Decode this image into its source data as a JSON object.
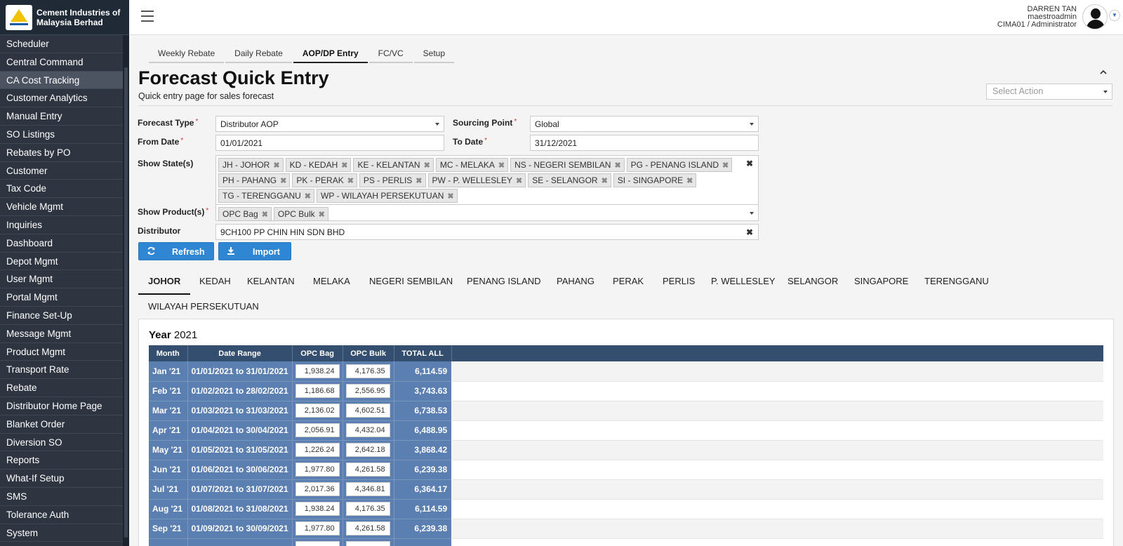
{
  "app": {
    "company_name_line1": "Cement Industries of",
    "company_name_line2": "Malaysia Berhad"
  },
  "sidebar": {
    "items": [
      {
        "label": "Scheduler"
      },
      {
        "label": "Central Command"
      },
      {
        "label": "CA Cost Tracking",
        "active": true
      },
      {
        "label": "Customer Analytics"
      },
      {
        "label": "Manual Entry"
      },
      {
        "label": "SO Listings"
      },
      {
        "label": "Rebates by PO"
      },
      {
        "label": "Customer"
      },
      {
        "label": "Tax Code"
      },
      {
        "label": "Vehicle Mgmt"
      },
      {
        "label": "Inquiries"
      },
      {
        "label": "Dashboard"
      },
      {
        "label": "Depot Mgmt"
      },
      {
        "label": "User Mgmt"
      },
      {
        "label": "Portal Mgmt"
      },
      {
        "label": "Finance Set-Up"
      },
      {
        "label": "Message Mgmt"
      },
      {
        "label": "Product Mgmt"
      },
      {
        "label": "Transport Rate"
      },
      {
        "label": "Rebate"
      },
      {
        "label": "Distributor Home Page"
      },
      {
        "label": "Blanket Order"
      },
      {
        "label": "Diversion SO"
      },
      {
        "label": "Reports"
      },
      {
        "label": "What-If Setup"
      },
      {
        "label": "SMS"
      },
      {
        "label": "Tolerance Auth"
      },
      {
        "label": "System"
      }
    ]
  },
  "user": {
    "name": "DARREN TAN",
    "login": "maestroadmin",
    "role": "CIMA01 / Administrator"
  },
  "tabs": [
    {
      "label": "Weekly Rebate"
    },
    {
      "label": "Daily Rebate"
    },
    {
      "label": "AOP/DP Entry",
      "active": true
    },
    {
      "label": "FC/VC"
    },
    {
      "label": "Setup"
    }
  ],
  "page": {
    "title": "Forecast Quick Entry",
    "subtitle": "Quick entry page for sales forecast",
    "action_placeholder": "Select Action"
  },
  "form": {
    "forecast_type": {
      "label": "Forecast Type",
      "value": "Distributor AOP"
    },
    "sourcing_point": {
      "label": "Sourcing Point",
      "value": "Global"
    },
    "from_date": {
      "label": "From Date",
      "value": "01/01/2021"
    },
    "to_date": {
      "label": "To Date",
      "value": "31/12/2021"
    },
    "states": {
      "label": "Show State(s)",
      "tags": [
        "JH - JOHOR",
        "KD - KEDAH",
        "KE - KELANTAN",
        "MC - MELAKA",
        "NS - NEGERI SEMBILAN",
        "PG - PENANG ISLAND",
        "PH - PAHANG",
        "PK - PERAK",
        "PS - PERLIS",
        "PW - P. WELLESLEY",
        "SE - SELANGOR",
        "SI - SINGAPORE",
        "TG - TERENGGANU",
        "WP - WILAYAH PERSEKUTUAN"
      ]
    },
    "products": {
      "label": "Show Product(s)",
      "tags": [
        "OPC Bag",
        "OPC Bulk"
      ]
    },
    "distributor": {
      "label": "Distributor",
      "value": "9CH100 PP CHIN HIN SDN BHD"
    },
    "refresh_label": "Refresh",
    "import_label": "Import",
    "icons": {
      "refresh": "refresh-icon",
      "import": "download-icon"
    }
  },
  "state_tabs": [
    {
      "label": "JOHOR",
      "active": true
    },
    {
      "label": "KEDAH"
    },
    {
      "label": "KELANTAN"
    },
    {
      "label": "MELAKA"
    },
    {
      "label": "NEGERI SEMBILAN"
    },
    {
      "label": "PENANG ISLAND"
    },
    {
      "label": "PAHANG"
    },
    {
      "label": "PERAK"
    },
    {
      "label": "PERLIS"
    },
    {
      "label": "P. WELLESLEY"
    },
    {
      "label": "SELANGOR"
    },
    {
      "label": "SINGAPORE"
    },
    {
      "label": "TERENGGANU"
    },
    {
      "label": "WILAYAH PERSEKUTUAN"
    }
  ],
  "forecast": {
    "year_label": "Year",
    "year": "2021",
    "columns": [
      "Month",
      "Date Range",
      "OPC Bag",
      "OPC Bulk",
      "TOTAL ALL"
    ],
    "rows": [
      {
        "month": "Jan '21",
        "range": "01/01/2021 to 31/01/2021",
        "bag": "1,938.24",
        "bulk": "4,176.35",
        "total": "6,114.59"
      },
      {
        "month": "Feb '21",
        "range": "01/02/2021 to 28/02/2021",
        "bag": "1,186.68",
        "bulk": "2,556.95",
        "total": "3,743.63"
      },
      {
        "month": "Mar '21",
        "range": "01/03/2021 to 31/03/2021",
        "bag": "2,136.02",
        "bulk": "4,602.51",
        "total": "6,738.53"
      },
      {
        "month": "Apr '21",
        "range": "01/04/2021 to 30/04/2021",
        "bag": "2,056.91",
        "bulk": "4,432.04",
        "total": "6,488.95"
      },
      {
        "month": "May '21",
        "range": "01/05/2021 to 31/05/2021",
        "bag": "1,226.24",
        "bulk": "2,642.18",
        "total": "3,868.42"
      },
      {
        "month": "Jun '21",
        "range": "01/06/2021 to 30/06/2021",
        "bag": "1,977.80",
        "bulk": "4,261.58",
        "total": "6,239.38"
      },
      {
        "month": "Jul '21",
        "range": "01/07/2021 to 31/07/2021",
        "bag": "2,017.36",
        "bulk": "4,346.81",
        "total": "6,364.17"
      },
      {
        "month": "Aug '21",
        "range": "01/08/2021 to 31/08/2021",
        "bag": "1,938.24",
        "bulk": "4,176.35",
        "total": "6,114.59"
      },
      {
        "month": "Sep '21",
        "range": "01/09/2021 to 30/09/2021",
        "bag": "1,977.80",
        "bulk": "4,261.58",
        "total": "6,239.38"
      },
      {
        "month": "",
        "range": "",
        "bag": "",
        "bulk": "",
        "total": ""
      }
    ]
  },
  "colors": {
    "sidebar_bg": "#2e3440",
    "table_header": "#344e70",
    "table_cell": "#5b7fb1",
    "button": "#2f86d2"
  }
}
